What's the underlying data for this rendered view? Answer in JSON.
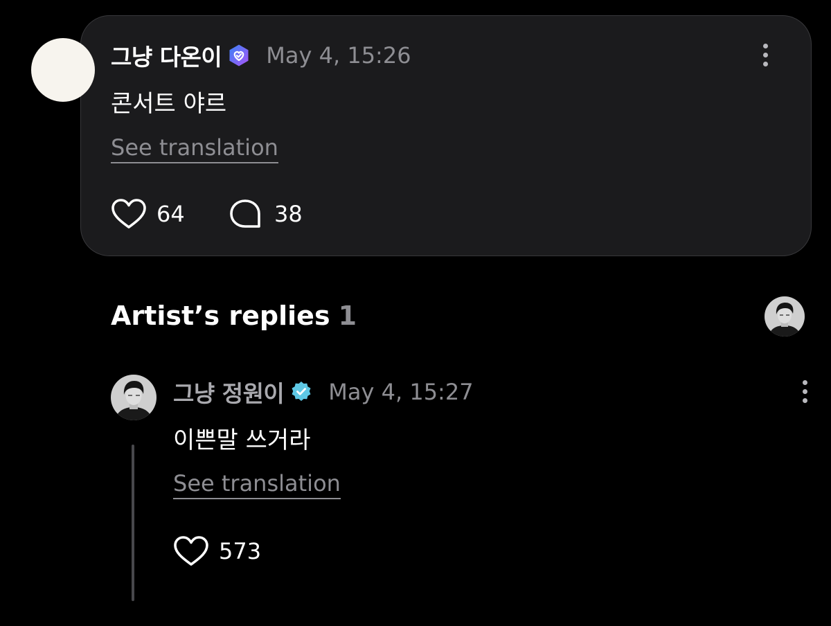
{
  "post": {
    "author": "그냥 다온이",
    "badge_icon": "verified-badge-purple",
    "timestamp": "May 4, 15:26",
    "text": "콘서트 야르",
    "see_translation": "See translation",
    "likes": "64",
    "comments": "38"
  },
  "replies_section": {
    "title": "Artist’s replies",
    "count": "1"
  },
  "reply": {
    "author": "그냥 정원이",
    "badge_icon": "verified-badge-teal",
    "timestamp": "May 4, 15:27",
    "text": "이쁜말 쓰거라",
    "see_translation": "See translation",
    "likes": "573"
  },
  "colors": {
    "background": "#000000",
    "card": "#1b1b1d",
    "card_border": "#38383b",
    "muted_text": "#8e8e93",
    "badge_purple": "#8a5cf6",
    "badge_blue": "#3b82f6",
    "badge_teal": "#5ec8e5"
  }
}
